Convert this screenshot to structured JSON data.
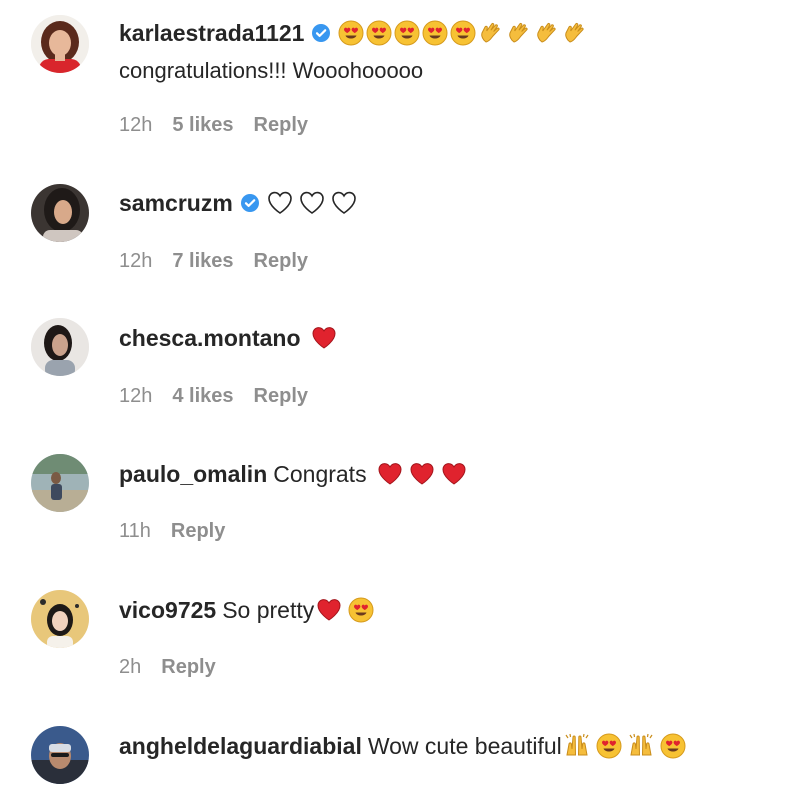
{
  "colors": {
    "username": "#262626",
    "meta": "#8e8e8e",
    "verified": "#3897f0",
    "heart_red": "#e0232e"
  },
  "comments": [
    {
      "username": "karlaestrada1121",
      "verified": true,
      "emojis": [
        "heart-eyes-emoji",
        "heart-eyes-emoji",
        "heart-eyes-emoji",
        "heart-eyes-emoji",
        "heart-eyes-emoji",
        "clapping-hands-emoji",
        "clapping-hands-emoji",
        "clapping-hands-emoji",
        "clapping-hands-emoji"
      ],
      "text_line2": "congratulations!!! Wooohooooo",
      "time": "12h",
      "likes": "5 likes",
      "reply": "Reply"
    },
    {
      "username": "samcruzm",
      "verified": true,
      "emojis": [
        "white-heart-emoji",
        "white-heart-emoji",
        "white-heart-emoji"
      ],
      "time": "12h",
      "likes": "7 likes",
      "reply": "Reply"
    },
    {
      "username": "chesca.montano",
      "verified": false,
      "emojis": [
        "red-heart-emoji"
      ],
      "time": "12h",
      "likes": "4 likes",
      "reply": "Reply"
    },
    {
      "username": "paulo_omalin",
      "verified": false,
      "text": "Congrats",
      "emojis": [
        "red-heart-emoji",
        "red-heart-emoji",
        "red-heart-emoji"
      ],
      "time": "11h",
      "reply": "Reply"
    },
    {
      "username": "vico9725",
      "verified": false,
      "text": "So pretty",
      "emojis": [
        "red-heart-emoji",
        "heart-eyes-emoji"
      ],
      "time": "2h",
      "reply": "Reply"
    },
    {
      "username": "angheldelaguardiabial",
      "verified": false,
      "text": "Wow cute beautiful",
      "emojis": [
        "raising-hands-emoji",
        "heart-eyes-emoji",
        "raising-hands-emoji",
        "heart-eyes-emoji"
      ]
    }
  ]
}
